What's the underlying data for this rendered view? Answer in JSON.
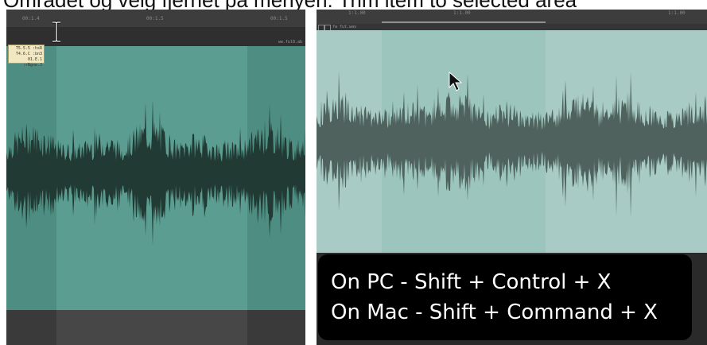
{
  "caption": "Området og velg fjernet på menyen: Trim item to selected area",
  "left_panel": {
    "ruler_ticks": [
      "00:1.4",
      "00:1.5",
      "00:1.5"
    ],
    "time_info": [
      "T5.5.5 :hsR",
      "T4.6.C :bn3",
      "01.E.1 :rBgne.J"
    ],
    "track_label": "ww.ful0.ab"
  },
  "right_panel": {
    "ruler_ticks": [
      "1:1.00",
      "1:1.00",
      "1:1.00"
    ],
    "track_label": "fa fut.wav",
    "shortcut_pc": "On PC - Shift + Control + X",
    "shortcut_mac": "On Mac - Shift + Command + X"
  },
  "colors": {
    "selection_teal": "#5b9e91",
    "unselected_teal": "#4e8e82",
    "right_selected": "#9bc5bd",
    "right_unselected": "#a8ccc5",
    "waveform_dark": "#223a34",
    "waveform_right": "#4f625d"
  },
  "icons": [
    "ibeam-cursor-icon",
    "arrow-cursor-icon"
  ]
}
